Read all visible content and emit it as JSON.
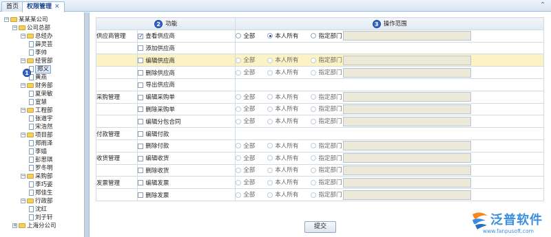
{
  "tabs": [
    {
      "label": "首页",
      "active": false
    },
    {
      "label": "权限管理",
      "active": true,
      "close": "✕"
    }
  ],
  "collapse_glyph": "⌃",
  "tree": [
    {
      "label": "某某某公司",
      "type": "folder",
      "toggle": "−"
    },
    {
      "label": "公司总部",
      "type": "folder",
      "toggle": "−"
    },
    {
      "label": "总经办",
      "type": "folder",
      "toggle": "−"
    },
    {
      "label": "薛灵芸",
      "type": "user"
    },
    {
      "label": "李帅",
      "type": "user"
    },
    {
      "label": "经营部",
      "type": "folder",
      "toggle": "−"
    },
    {
      "label": "郑义",
      "type": "user",
      "selected": true
    },
    {
      "label": "黄燕",
      "type": "user"
    },
    {
      "label": "财务部",
      "type": "folder",
      "toggle": "−"
    },
    {
      "label": "夏荣敏",
      "type": "user"
    },
    {
      "label": "宣慧",
      "type": "user"
    },
    {
      "label": "工程部",
      "type": "folder",
      "toggle": "−"
    },
    {
      "label": "张道宇",
      "type": "user"
    },
    {
      "label": "宋浩然",
      "type": "user"
    },
    {
      "label": "项目部",
      "type": "folder",
      "toggle": "−"
    },
    {
      "label": "郑雨泽",
      "type": "user"
    },
    {
      "label": "李嫱",
      "type": "user"
    },
    {
      "label": "彭思琪",
      "type": "user"
    },
    {
      "label": "罗冬明",
      "type": "user"
    },
    {
      "label": "采购部",
      "type": "folder",
      "toggle": "−"
    },
    {
      "label": "李巧姿",
      "type": "user"
    },
    {
      "label": "郑佳生",
      "type": "user"
    },
    {
      "label": "行政部",
      "type": "folder",
      "toggle": "−"
    },
    {
      "label": "沈红",
      "type": "user"
    },
    {
      "label": "刘子轩",
      "type": "user"
    },
    {
      "label": "上海分公司",
      "type": "folder",
      "toggle": "+"
    }
  ],
  "markers": {
    "one": "1",
    "two": "2",
    "three": "3"
  },
  "table": {
    "col_function": "功能",
    "col_scope": "操作范围",
    "scope_options": [
      "全部",
      "本人所有",
      "指定部门"
    ],
    "rows": [
      {
        "group": "供应商管理",
        "func": "查看供应商",
        "checked": true,
        "scope": "本人所有",
        "scope_enabled": true
      },
      {
        "group": "",
        "func": "添加供应商",
        "checked": false,
        "has_scope": false
      },
      {
        "group": "",
        "func": "编辑供应商",
        "checked": false,
        "scope": "",
        "scope_enabled": false,
        "highlight": true
      },
      {
        "group": "",
        "func": "删除供应商",
        "checked": false,
        "scope": "",
        "scope_enabled": false
      },
      {
        "group": "",
        "func": "导出供应商",
        "checked": false,
        "has_scope": false
      },
      {
        "group": "采购管理",
        "func": "编辑采购单",
        "checked": false,
        "scope": "",
        "scope_enabled": false
      },
      {
        "group": "",
        "func": "删除采购单",
        "checked": false,
        "scope": "",
        "scope_enabled": false
      },
      {
        "group": "",
        "func": "编辑分包合同",
        "checked": false,
        "scope": "",
        "scope_enabled": false
      },
      {
        "group": "付款管理",
        "func": "编辑付款",
        "checked": false,
        "has_scope": false
      },
      {
        "group": "",
        "func": "删除付款",
        "checked": false,
        "scope": "",
        "scope_enabled": false
      },
      {
        "group": "收货管理",
        "func": "编辑收货",
        "checked": false,
        "scope": "",
        "scope_enabled": false
      },
      {
        "group": "",
        "func": "删除收货",
        "checked": false,
        "scope": "",
        "scope_enabled": false
      },
      {
        "group": "发票管理",
        "func": "编辑发票",
        "checked": false,
        "scope": "",
        "scope_enabled": false
      },
      {
        "group": "",
        "func": "删除发票",
        "checked": false,
        "scope": "",
        "scope_enabled": false
      }
    ]
  },
  "submit_label": "提交",
  "brand": {
    "name": "泛普软件",
    "url": "www.fanpusoft.com",
    "color": "#3a8de0"
  },
  "colors": {
    "highlight_row": "#fbf3c6",
    "marker": "#3566c9",
    "accent": "#15428b"
  }
}
